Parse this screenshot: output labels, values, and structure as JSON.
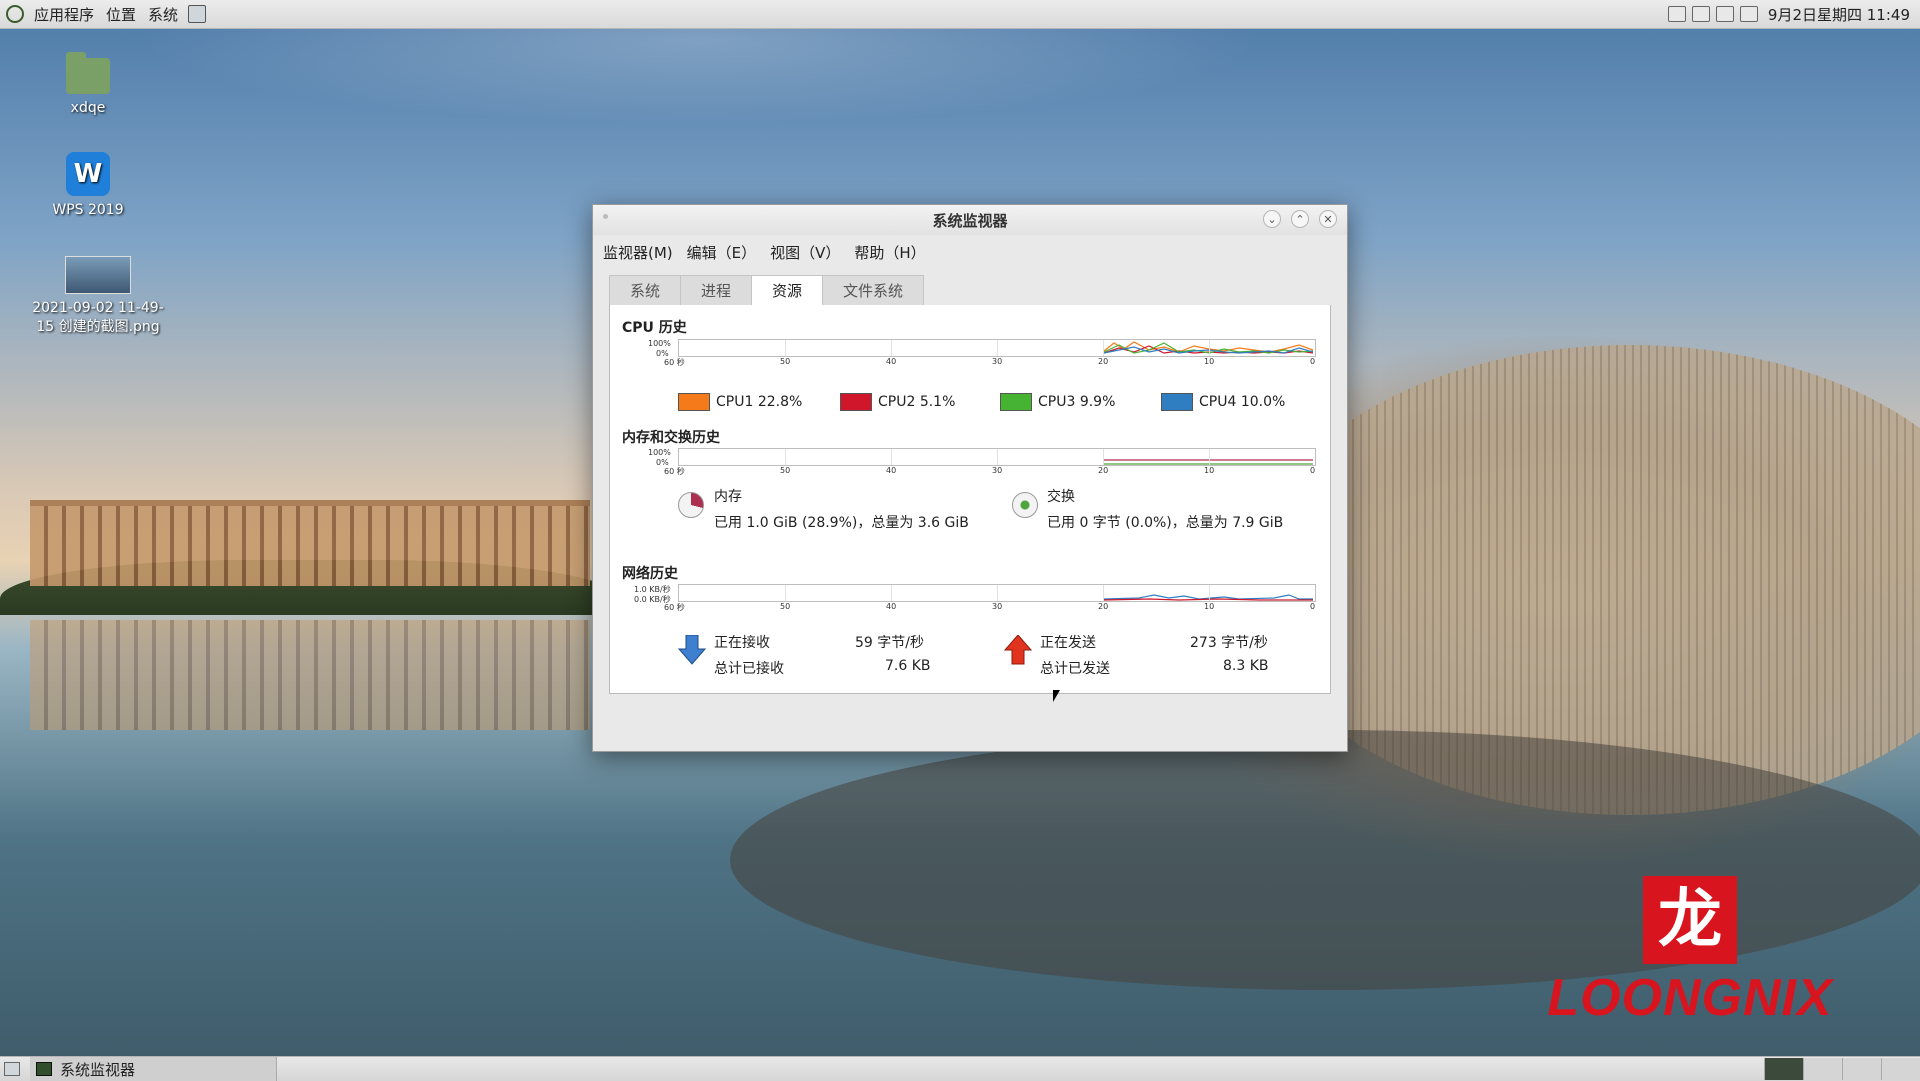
{
  "top_panel": {
    "applications": "应用程序",
    "places": "位置",
    "system": "系统",
    "clock": "9月2日星期四 11:49"
  },
  "desktop": {
    "icons": [
      {
        "label": "xdqe",
        "icon": "home-folder-icon"
      },
      {
        "label": "WPS 2019",
        "icon": "wps-icon"
      },
      {
        "label": "2021-09-02 11-49-15 创建的截图.png",
        "icon": "image-thumbnail-icon"
      }
    ],
    "brand": {
      "seal": "龙",
      "text": "LOONGNIX"
    }
  },
  "window": {
    "title": "系统监视器",
    "menu": [
      "监视器(M)",
      "编辑（E）",
      "视图（V）",
      "帮助（H）"
    ],
    "tabs": [
      {
        "label": "系统",
        "active": false
      },
      {
        "label": "进程",
        "active": false
      },
      {
        "label": "资源",
        "active": true
      },
      {
        "label": "文件系统",
        "active": false
      }
    ]
  },
  "resources": {
    "cpu": {
      "title": "CPU 历史",
      "y_max": "100%",
      "y_min": "0%",
      "x_ticks": [
        "60 秒",
        "50",
        "40",
        "30",
        "20",
        "10",
        "0"
      ],
      "legend": [
        {
          "label": "CPU1",
          "value": "22.8%",
          "color": "#f57b1a"
        },
        {
          "label": "CPU2",
          "value": "5.1%",
          "color": "#d0162b"
        },
        {
          "label": "CPU3",
          "value": "9.9%",
          "color": "#47b332"
        },
        {
          "label": "CPU4",
          "value": "10.0%",
          "color": "#2e7ec1"
        }
      ]
    },
    "memory": {
      "title": "内存和交换历史",
      "y_max": "100%",
      "y_min": "0%",
      "x_ticks": [
        "60 秒",
        "50",
        "40",
        "30",
        "20",
        "10",
        "0"
      ],
      "mem_label": "内存",
      "mem_detail": "已用 1.0 GiB (28.9%)，总量为 3.6 GiB",
      "swap_label": "交换",
      "swap_detail": "已用 0 字节 (0.0%)，总量为 7.9 GiB",
      "mem_color": "#ad2f4f",
      "swap_color": "#4fa43c",
      "mem_percent": 28.9,
      "swap_percent": 0.0
    },
    "network": {
      "title": "网络历史",
      "y_max": "1.0 KB/秒",
      "y_min": "0.0 KB/秒",
      "x_ticks": [
        "60 秒",
        "50",
        "40",
        "30",
        "20",
        "10",
        "0"
      ],
      "receiving_label": "正在接收",
      "receiving_value": "59 字节/秒",
      "total_received_label": "总计已接收",
      "total_received_value": "7.6 KB",
      "sending_label": "正在发送",
      "sending_value": "273 字节/秒",
      "total_sent_label": "总计已发送",
      "total_sent_value": "8.3 KB"
    }
  },
  "taskbar": {
    "task_label": "系统监视器"
  }
}
